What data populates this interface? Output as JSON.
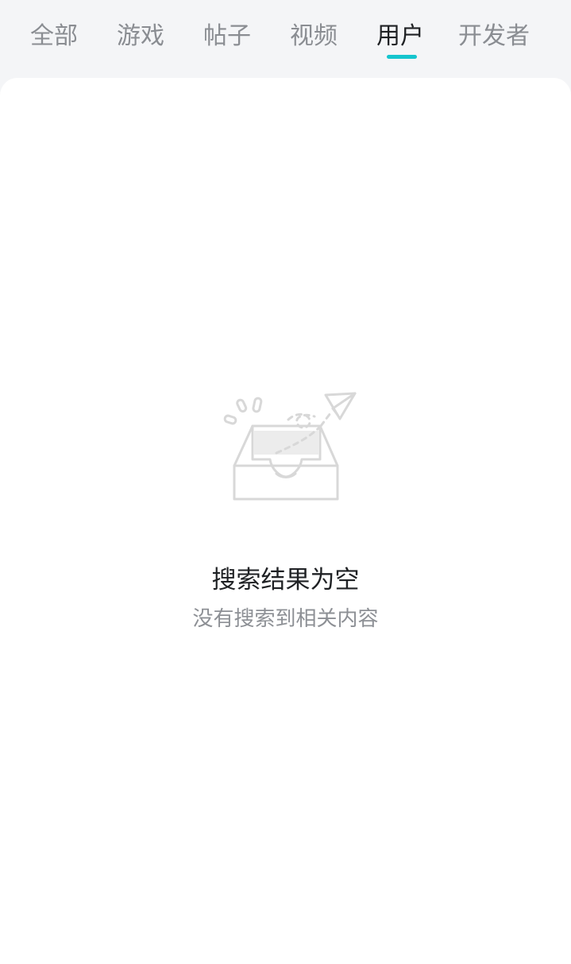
{
  "tabs": [
    {
      "label": "全部"
    },
    {
      "label": "游戏"
    },
    {
      "label": "帖子"
    },
    {
      "label": "视频"
    },
    {
      "label": "用户"
    },
    {
      "label": "开发者"
    }
  ],
  "active_tab": "用户",
  "accent_color": "#15c5ce",
  "empty_state": {
    "icon": "empty-inbox-paper-plane-icon",
    "title": "搜索结果为空",
    "subtitle": "没有搜索到相关内容"
  }
}
